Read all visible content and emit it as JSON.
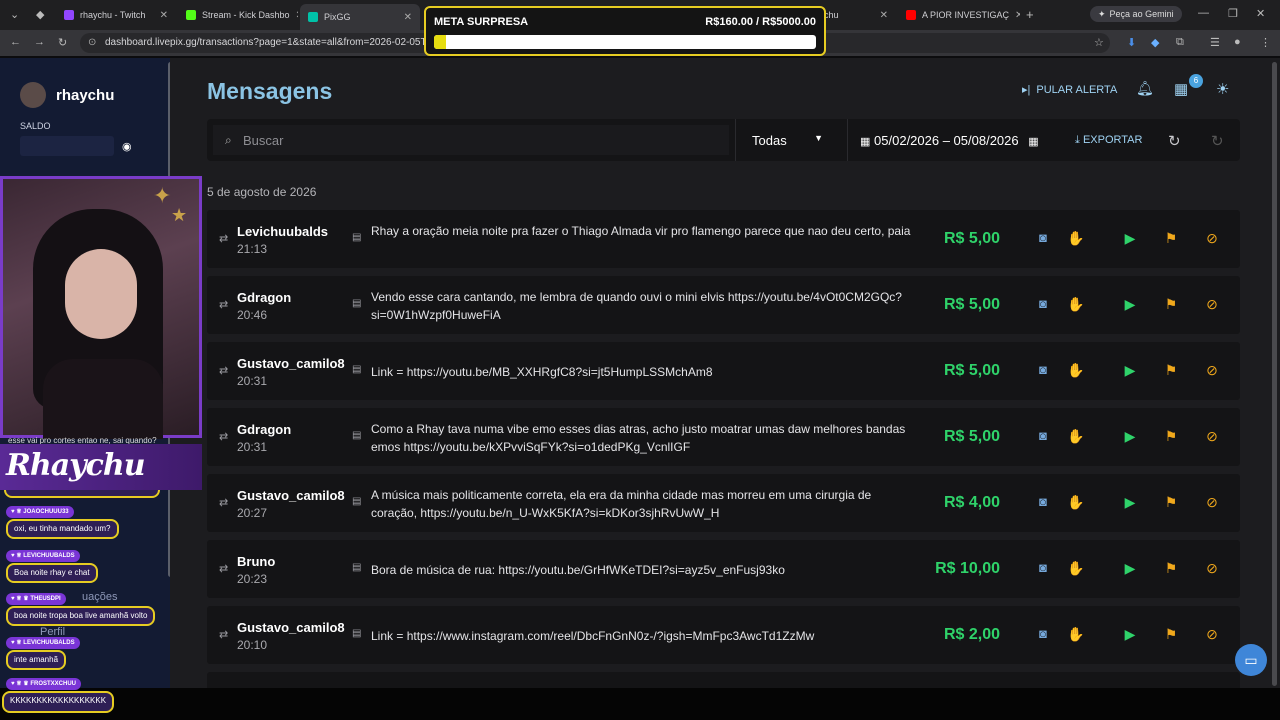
{
  "browser": {
    "tabs": [
      {
        "title": "rhaychu - Twitch",
        "favcolor": "#9146ff"
      },
      {
        "title": "Stream - Kick Dashbo",
        "favcolor": "#53fc18"
      },
      {
        "title": "PixGG",
        "favcolor": "#00c2a8"
      },
      {
        "title": "chu",
        "favcolor": "#444"
      },
      {
        "title": "A PIOR INVESTIGAÇ",
        "favcolor": "#ff0000"
      }
    ],
    "url": "dashboard.livepix.gg/transactions?page=1&state=all&from=2026-02-05T00",
    "gemini_label": "Peça ao Gemini"
  },
  "goal": {
    "label": "META SURPRESA",
    "amount": "R$160.00 / R$5000.00",
    "progress": 0.032
  },
  "sidebar": {
    "username": "rhaychu",
    "saldo_label": "SALDO",
    "partial_items": [
      "uações",
      "Perfil"
    ]
  },
  "stream": {
    "logo_text": "Rhaychu",
    "top_chat_line": "esse vai pro cortes entao ne, sai quando?",
    "chat": [
      {
        "user": "JOAOCHUUU33",
        "text": "oxi, eu tinha mandado um?"
      },
      {
        "user": "LEVICHUUBALDS",
        "text": "Boa noite rhay e chat"
      },
      {
        "user": "THEUSDPI",
        "text": "boa noite tropa boa live amanhã volto"
      },
      {
        "user": "LEVICHUUBALDS",
        "text": "inte amanhã"
      },
      {
        "user": "FROSTXXCHUU",
        "text": "KKKKKKKKKKKKKKKKKK"
      }
    ]
  },
  "main": {
    "title": "Mensagens",
    "skip_alert": "PULAR ALERTA",
    "notification_count": "6",
    "search_placeholder": "Buscar",
    "filter_selected": "Todas",
    "date_range": "05/02/2026 – 05/08/2026",
    "export_label": "EXPORTAR",
    "date_group": "5 de agosto de 2026",
    "colors": {
      "accent": "#8bc4e4",
      "amount": "#2fd36a",
      "flag": "#f0a81c"
    },
    "rows": [
      {
        "name": "Levichuubalds",
        "time": "21:13",
        "message": "Rhay a oração meia noite pra fazer o Thiago Almada vir pro flamengo parece que nao deu certo, paia",
        "amount": "R$ 5,00"
      },
      {
        "name": "Gdragon",
        "time": "20:46",
        "message": "Vendo esse cara cantando, me lembra de quando ouvi o mini elvis https://youtu.be/4vOt0CM2GQc?si=0W1hWzpf0HuweFiA",
        "amount": "R$ 5,00"
      },
      {
        "name": "Gustavo_camilo8",
        "time": "20:31",
        "message": "Link = https://youtu.be/MB_XXHRgfC8?si=jt5HumpLSSMchAm8",
        "amount": "R$ 5,00"
      },
      {
        "name": "Gdragon",
        "time": "20:31",
        "message": "Como a Rhay tava numa vibe emo esses dias atras, acho justo moatrar umas daw melhores bandas emos https://youtu.be/kXPvviSqFYk?si=o1dedPKg_VcnlIGF",
        "amount": "R$ 5,00"
      },
      {
        "name": "Gustavo_camilo8",
        "time": "20:27",
        "message": "A música mais politicamente correta, ela era da minha cidade mas morreu em uma cirurgia de coração, https://youtu.be/n_U-WxK5KfA?si=kDKor3sjhRvUwW_H",
        "amount": "R$ 4,00"
      },
      {
        "name": "Bruno",
        "time": "20:23",
        "message": "Bora de música de rua: https://youtu.be/GrHfWKeTDEI?si=ayz5v_enFusj93ko",
        "amount": "R$ 10,00"
      },
      {
        "name": "Gustavo_camilo8",
        "time": "20:10",
        "message": "Link = https://www.instagram.com/reel/DbcFnGnN0z-/?igsh=MmFpc3AwcTd1ZzMw",
        "amount": "R$ 2,00"
      }
    ]
  }
}
